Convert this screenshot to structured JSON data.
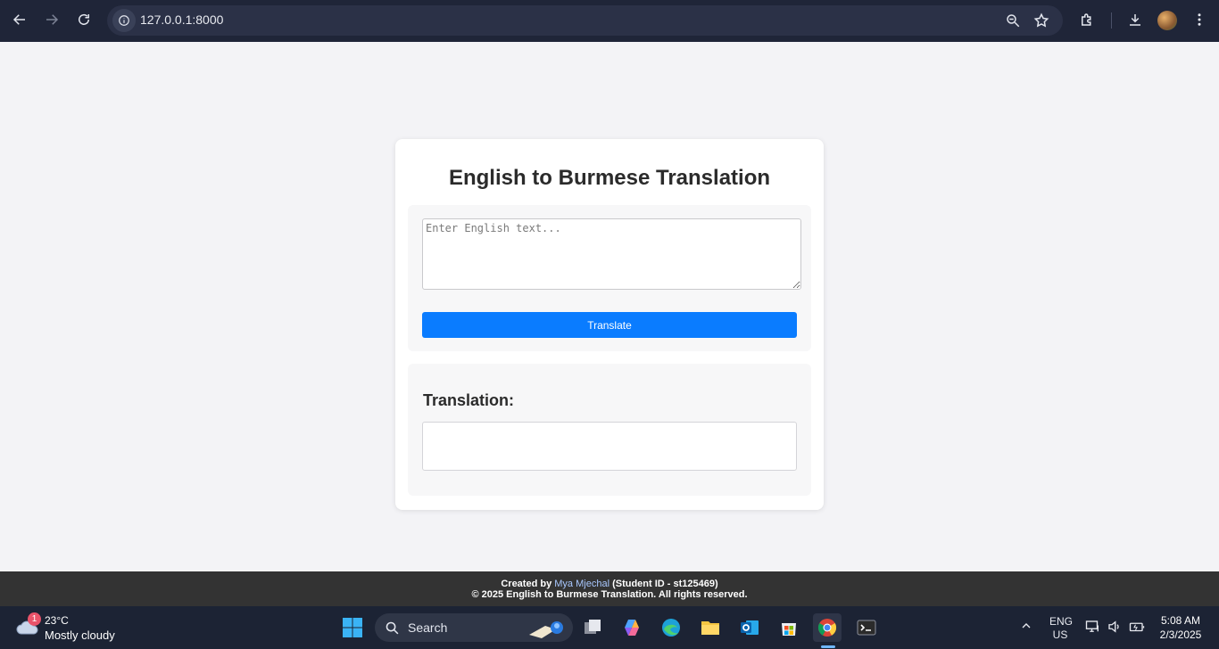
{
  "browser": {
    "url": "127.0.0.1:8000"
  },
  "page": {
    "title": "English to Burmese Translation",
    "input_placeholder": "Enter English text...",
    "input_value": "",
    "translate_button": "Translate",
    "output_label": "Translation:",
    "output_value": ""
  },
  "footer": {
    "created_by_prefix": "Created by ",
    "author": "Mya Mjechal",
    "student_id": " (Student ID - st125469)",
    "copyright": "© 2025 English to Burmese Translation. All rights reserved."
  },
  "taskbar": {
    "weather_badge": "1",
    "temperature": "23°C",
    "condition": "Mostly cloudy",
    "search_label": "Search",
    "language_line1": "ENG",
    "language_line2": "US",
    "time": "5:08 AM",
    "date": "2/3/2025"
  },
  "colors": {
    "primary_button": "#0a7cff",
    "footer_bg": "#333333",
    "chrome_bg": "#1f2538",
    "page_bg": "#f3f3f6"
  }
}
